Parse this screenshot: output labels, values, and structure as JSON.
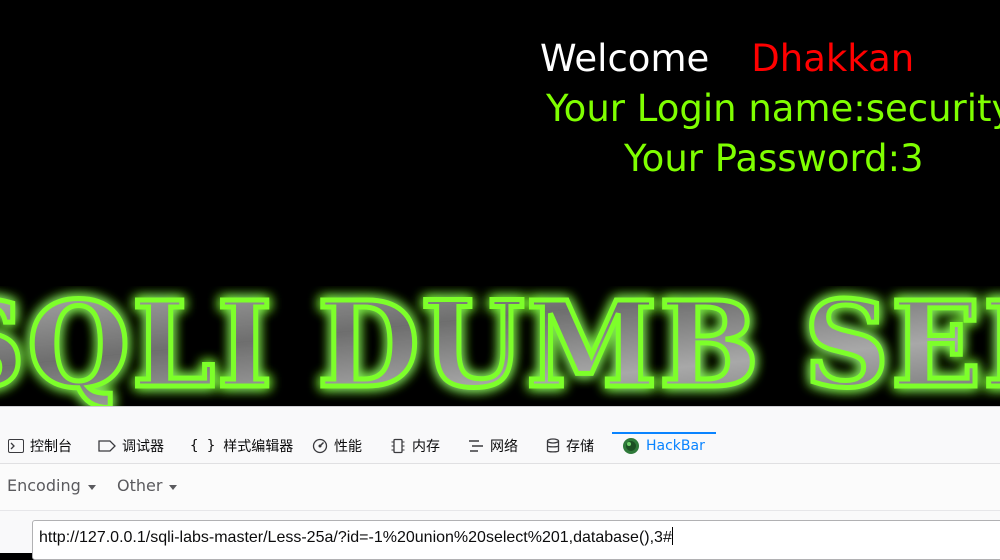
{
  "page": {
    "welcome_word": "Welcome",
    "user_name": "Dhakkan",
    "login_line": "Your Login name:security",
    "password_line": "Your Password:3",
    "banner_text": "SQLI DUMB SERIES"
  },
  "devtools": {
    "tabs": [
      {
        "label": "控制台",
        "icon": "console-icon"
      },
      {
        "label": "调试器",
        "icon": "debugger-icon"
      },
      {
        "label": "样式编辑器",
        "icon": "style-editor-icon"
      },
      {
        "label": "性能",
        "icon": "performance-icon"
      },
      {
        "label": "内存",
        "icon": "memory-icon"
      },
      {
        "label": "网络",
        "icon": "network-icon"
      },
      {
        "label": "存储",
        "icon": "storage-icon"
      },
      {
        "label": "HackBar",
        "icon": "hackbar-icon"
      }
    ],
    "active_tab": "HackBar"
  },
  "hackbar": {
    "encoding_label": "Encoding",
    "other_label": "Other",
    "url_value": "http://127.0.0.1/sqli-labs-master/Less-25a/?id=-1%20union%20select%201,database(),3#"
  },
  "colors": {
    "welcome": "#ffffff",
    "user_name": "#ff0000",
    "login_text": "#7fff00",
    "banner_glow": "#6cff1a",
    "active_tab": "#0a84ff"
  }
}
